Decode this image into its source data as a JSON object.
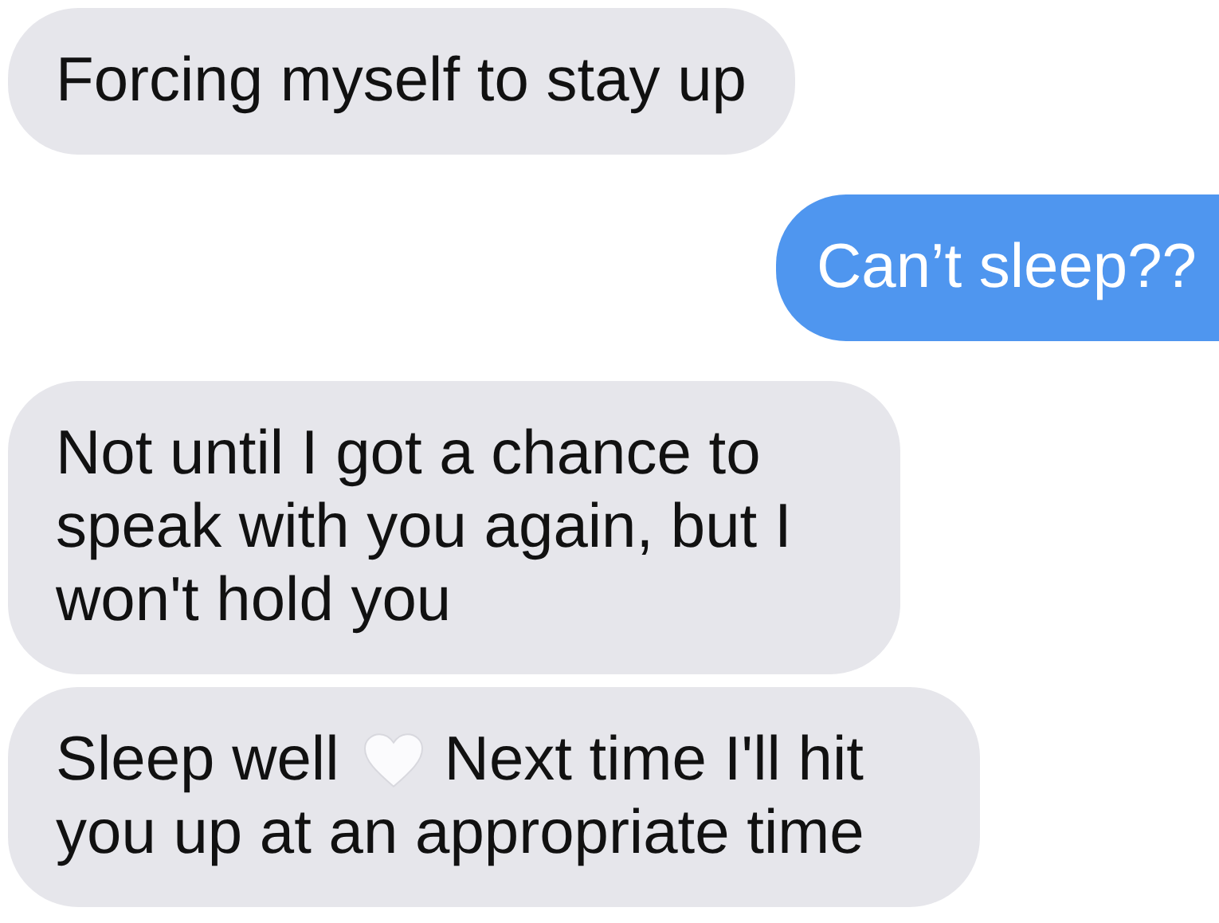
{
  "messages": [
    {
      "kind": "incoming",
      "parts": [
        {
          "kind": "text",
          "text": "Forcing myself to stay up"
        }
      ]
    },
    {
      "kind": "outgoing",
      "parts": [
        {
          "kind": "text",
          "text": "Can’t sleep??"
        }
      ]
    },
    {
      "kind": "incoming",
      "parts": [
        {
          "kind": "text",
          "text": "Not until I got a chance to speak with you again, but I won't hold you"
        }
      ]
    },
    {
      "kind": "incoming",
      "parts": [
        {
          "kind": "text",
          "text": "Sleep well"
        },
        {
          "kind": "heart"
        },
        {
          "kind": "text",
          "text": "Next time I'll hit"
        },
        {
          "kind": "text",
          "text": "you up at an appropriate time"
        }
      ]
    }
  ]
}
